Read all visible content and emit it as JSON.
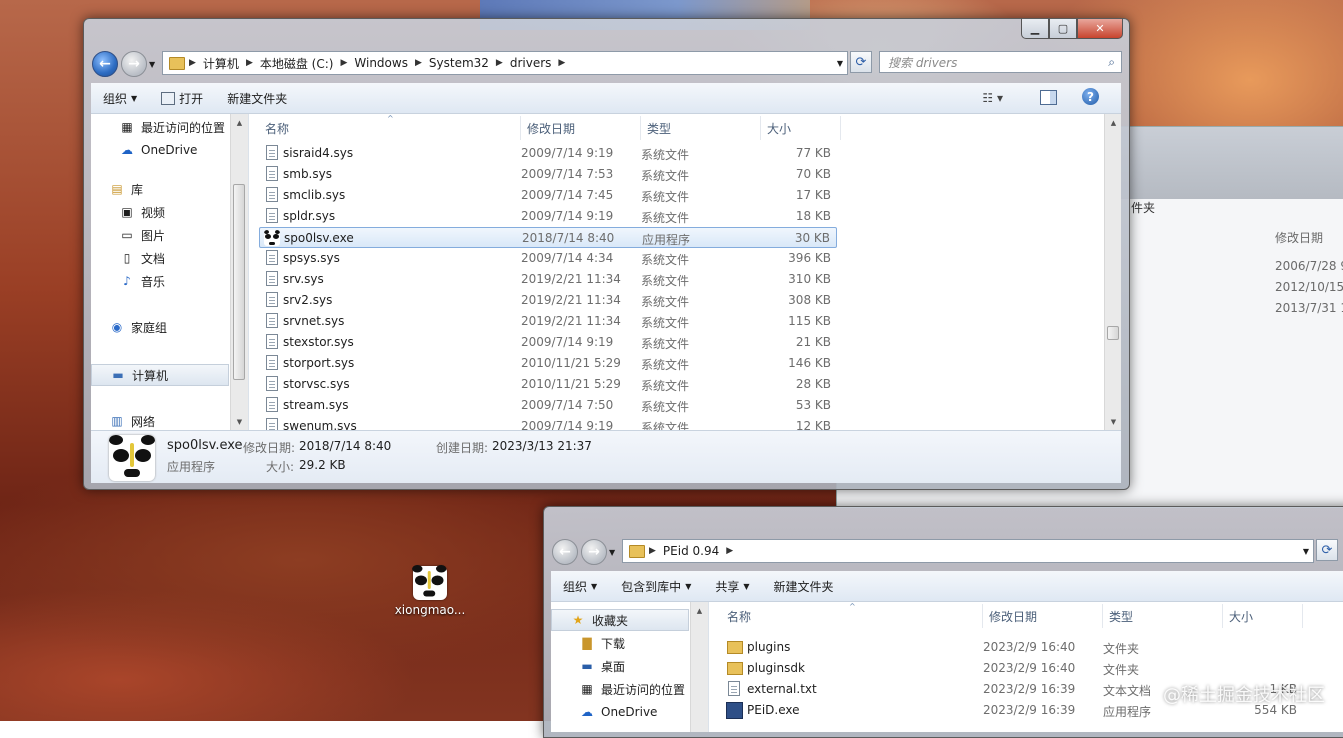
{
  "desktop": {
    "icon_label": "xiongmao...",
    "watermark": "@稀土掘金技术社区"
  },
  "back_window": {
    "toolbar_fragment": "件夹",
    "column_date": "修改日期",
    "dates": [
      "2006/7/28 9",
      "2012/10/15",
      "2013/7/31 1"
    ]
  },
  "main_window": {
    "breadcrumb": [
      "计算机",
      "本地磁盘 (C:)",
      "Windows",
      "System32",
      "drivers"
    ],
    "search_placeholder": "搜索 drivers",
    "toolbar": {
      "organize": "组织",
      "open": "打开",
      "new_folder": "新建文件夹"
    },
    "nav": [
      {
        "label": "最近访问的位置",
        "icon": "recent-places-icon"
      },
      {
        "label": "OneDrive",
        "icon": "onedrive-icon"
      },
      {
        "label": "库",
        "icon": "library-icon"
      },
      {
        "label": "视频",
        "icon": "video-library-icon"
      },
      {
        "label": "图片",
        "icon": "pictures-library-icon"
      },
      {
        "label": "文档",
        "icon": "documents-library-icon"
      },
      {
        "label": "音乐",
        "icon": "music-library-icon"
      },
      {
        "label": "家庭组",
        "icon": "homegroup-icon"
      },
      {
        "label": "计算机",
        "icon": "computer-icon"
      },
      {
        "label": "网络",
        "icon": "network-icon"
      }
    ],
    "columns": {
      "name": "名称",
      "date": "修改日期",
      "type": "类型",
      "size": "大小"
    },
    "files": [
      {
        "name": "sisraid4.sys",
        "date": "2009/7/14 9:19",
        "type": "系统文件",
        "size": "77 KB"
      },
      {
        "name": "smb.sys",
        "date": "2009/7/14 7:53",
        "type": "系统文件",
        "size": "70 KB"
      },
      {
        "name": "smclib.sys",
        "date": "2009/7/14 7:45",
        "type": "系统文件",
        "size": "17 KB"
      },
      {
        "name": "spldr.sys",
        "date": "2009/7/14 9:19",
        "type": "系统文件",
        "size": "18 KB"
      },
      {
        "name": "spo0lsv.exe",
        "date": "2018/7/14 8:40",
        "type": "应用程序",
        "size": "30 KB",
        "selected": true
      },
      {
        "name": "spsys.sys",
        "date": "2009/7/14 4:34",
        "type": "系统文件",
        "size": "396 KB"
      },
      {
        "name": "srv.sys",
        "date": "2019/2/21 11:34",
        "type": "系统文件",
        "size": "310 KB"
      },
      {
        "name": "srv2.sys",
        "date": "2019/2/21 11:34",
        "type": "系统文件",
        "size": "308 KB"
      },
      {
        "name": "srvnet.sys",
        "date": "2019/2/21 11:34",
        "type": "系统文件",
        "size": "115 KB"
      },
      {
        "name": "stexstor.sys",
        "date": "2009/7/14 9:19",
        "type": "系统文件",
        "size": "21 KB"
      },
      {
        "name": "storport.sys",
        "date": "2010/11/21 5:29",
        "type": "系统文件",
        "size": "146 KB"
      },
      {
        "name": "storvsc.sys",
        "date": "2010/11/21 5:29",
        "type": "系统文件",
        "size": "28 KB"
      },
      {
        "name": "stream.sys",
        "date": "2009/7/14 7:50",
        "type": "系统文件",
        "size": "53 KB"
      },
      {
        "name": "swenum.sys",
        "date": "2009/7/14 9:19",
        "type": "系统文件",
        "size": "12 KB"
      }
    ],
    "details": {
      "filename": "spo0lsv.exe",
      "modified_label": "修改日期:",
      "modified_value": "2018/7/14 8:40",
      "created_label": "创建日期:",
      "created_value": "2023/3/13 21:37",
      "type": "应用程序",
      "size_label": "大小:",
      "size_value": "29.2 KB"
    }
  },
  "peid_window": {
    "breadcrumb": [
      "PEid 0.94"
    ],
    "toolbar": {
      "organize": "组织",
      "include_library": "包含到库中",
      "share": "共享",
      "new_folder": "新建文件夹"
    },
    "nav": [
      {
        "label": "收藏夹",
        "icon": "favorites-star-icon"
      },
      {
        "label": "下载",
        "icon": "downloads-icon"
      },
      {
        "label": "桌面",
        "icon": "desktop-icon"
      },
      {
        "label": "最近访问的位置",
        "icon": "recent-places-icon"
      },
      {
        "label": "OneDrive",
        "icon": "onedrive-icon"
      }
    ],
    "columns": {
      "name": "名称",
      "date": "修改日期",
      "type": "类型",
      "size": "大小"
    },
    "files": [
      {
        "name": "plugins",
        "date": "2023/2/9 16:40",
        "type": "文件夹",
        "size": ""
      },
      {
        "name": "pluginsdk",
        "date": "2023/2/9 16:40",
        "type": "文件夹",
        "size": ""
      },
      {
        "name": "external.txt",
        "date": "2023/2/9 16:39",
        "type": "文本文档",
        "size": "1 KB"
      },
      {
        "name": "PEiD.exe",
        "date": "2023/2/9 16:39",
        "type": "应用程序",
        "size": "554 KB"
      }
    ]
  }
}
